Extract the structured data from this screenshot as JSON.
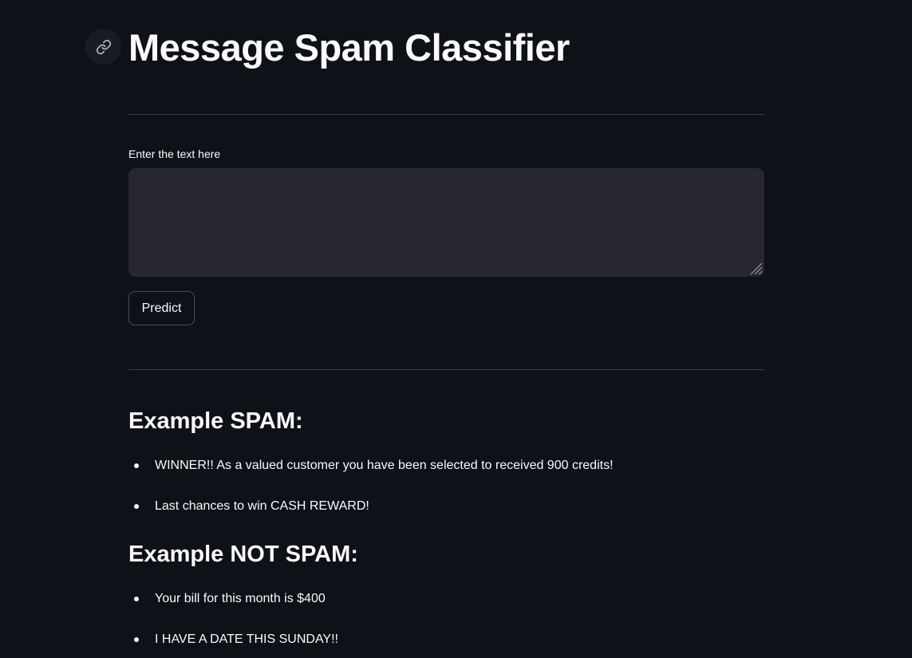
{
  "page": {
    "title": "Message Spam Classifier"
  },
  "input": {
    "label": "Enter the text here",
    "value": "",
    "placeholder": ""
  },
  "actions": {
    "predict_label": "Predict"
  },
  "examples": {
    "spam": {
      "heading": "Example SPAM:",
      "items": [
        "WINNER!! As a valued customer you have been selected to received 900 credits!",
        "Last chances to win CASH REWARD!"
      ]
    },
    "not_spam": {
      "heading": "Example NOT SPAM:",
      "items": [
        "Your bill for this month is $400",
        "I HAVE A DATE THIS SUNDAY!!"
      ]
    }
  },
  "icons": {
    "anchor": "link-icon",
    "bullet": "bullet-dot-icon",
    "resize": "resize-grip-icon"
  },
  "colors": {
    "background": "#0e1117",
    "text": "#fafafa",
    "input_background": "#262730",
    "divider": "#3a3d45",
    "button_border": "#4a4d56",
    "anchor_background": "#191c24"
  }
}
